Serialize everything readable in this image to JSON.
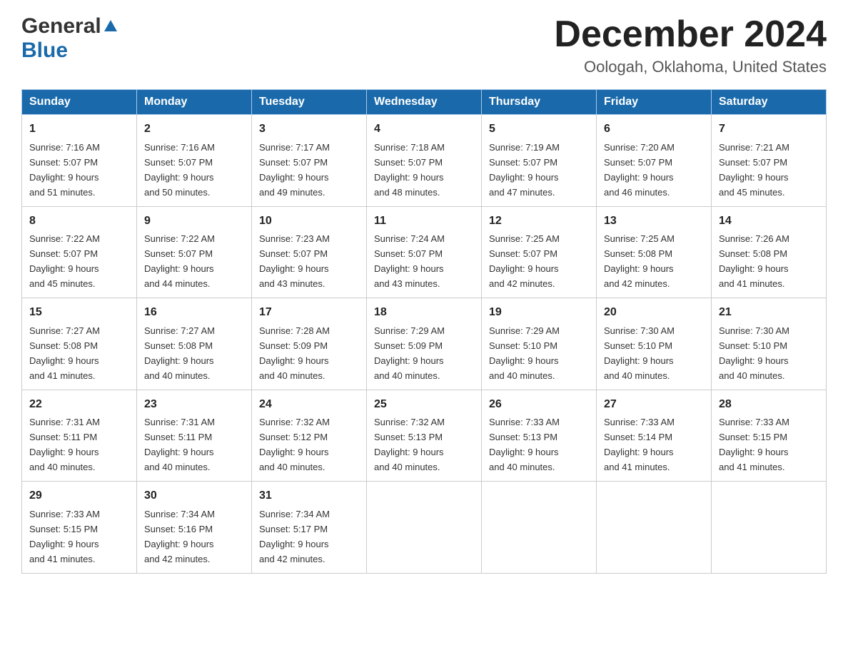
{
  "header": {
    "logo_general": "General",
    "logo_blue": "Blue",
    "month_title": "December 2024",
    "location": "Oologah, Oklahoma, United States"
  },
  "days_of_week": [
    "Sunday",
    "Monday",
    "Tuesday",
    "Wednesday",
    "Thursday",
    "Friday",
    "Saturday"
  ],
  "weeks": [
    [
      {
        "day": "1",
        "sunrise": "7:16 AM",
        "sunset": "5:07 PM",
        "daylight": "9 hours and 51 minutes."
      },
      {
        "day": "2",
        "sunrise": "7:16 AM",
        "sunset": "5:07 PM",
        "daylight": "9 hours and 50 minutes."
      },
      {
        "day": "3",
        "sunrise": "7:17 AM",
        "sunset": "5:07 PM",
        "daylight": "9 hours and 49 minutes."
      },
      {
        "day": "4",
        "sunrise": "7:18 AM",
        "sunset": "5:07 PM",
        "daylight": "9 hours and 48 minutes."
      },
      {
        "day": "5",
        "sunrise": "7:19 AM",
        "sunset": "5:07 PM",
        "daylight": "9 hours and 47 minutes."
      },
      {
        "day": "6",
        "sunrise": "7:20 AM",
        "sunset": "5:07 PM",
        "daylight": "9 hours and 46 minutes."
      },
      {
        "day": "7",
        "sunrise": "7:21 AM",
        "sunset": "5:07 PM",
        "daylight": "9 hours and 45 minutes."
      }
    ],
    [
      {
        "day": "8",
        "sunrise": "7:22 AM",
        "sunset": "5:07 PM",
        "daylight": "9 hours and 45 minutes."
      },
      {
        "day": "9",
        "sunrise": "7:22 AM",
        "sunset": "5:07 PM",
        "daylight": "9 hours and 44 minutes."
      },
      {
        "day": "10",
        "sunrise": "7:23 AM",
        "sunset": "5:07 PM",
        "daylight": "9 hours and 43 minutes."
      },
      {
        "day": "11",
        "sunrise": "7:24 AM",
        "sunset": "5:07 PM",
        "daylight": "9 hours and 43 minutes."
      },
      {
        "day": "12",
        "sunrise": "7:25 AM",
        "sunset": "5:07 PM",
        "daylight": "9 hours and 42 minutes."
      },
      {
        "day": "13",
        "sunrise": "7:25 AM",
        "sunset": "5:08 PM",
        "daylight": "9 hours and 42 minutes."
      },
      {
        "day": "14",
        "sunrise": "7:26 AM",
        "sunset": "5:08 PM",
        "daylight": "9 hours and 41 minutes."
      }
    ],
    [
      {
        "day": "15",
        "sunrise": "7:27 AM",
        "sunset": "5:08 PM",
        "daylight": "9 hours and 41 minutes."
      },
      {
        "day": "16",
        "sunrise": "7:27 AM",
        "sunset": "5:08 PM",
        "daylight": "9 hours and 40 minutes."
      },
      {
        "day": "17",
        "sunrise": "7:28 AM",
        "sunset": "5:09 PM",
        "daylight": "9 hours and 40 minutes."
      },
      {
        "day": "18",
        "sunrise": "7:29 AM",
        "sunset": "5:09 PM",
        "daylight": "9 hours and 40 minutes."
      },
      {
        "day": "19",
        "sunrise": "7:29 AM",
        "sunset": "5:10 PM",
        "daylight": "9 hours and 40 minutes."
      },
      {
        "day": "20",
        "sunrise": "7:30 AM",
        "sunset": "5:10 PM",
        "daylight": "9 hours and 40 minutes."
      },
      {
        "day": "21",
        "sunrise": "7:30 AM",
        "sunset": "5:10 PM",
        "daylight": "9 hours and 40 minutes."
      }
    ],
    [
      {
        "day": "22",
        "sunrise": "7:31 AM",
        "sunset": "5:11 PM",
        "daylight": "9 hours and 40 minutes."
      },
      {
        "day": "23",
        "sunrise": "7:31 AM",
        "sunset": "5:11 PM",
        "daylight": "9 hours and 40 minutes."
      },
      {
        "day": "24",
        "sunrise": "7:32 AM",
        "sunset": "5:12 PM",
        "daylight": "9 hours and 40 minutes."
      },
      {
        "day": "25",
        "sunrise": "7:32 AM",
        "sunset": "5:13 PM",
        "daylight": "9 hours and 40 minutes."
      },
      {
        "day": "26",
        "sunrise": "7:33 AM",
        "sunset": "5:13 PM",
        "daylight": "9 hours and 40 minutes."
      },
      {
        "day": "27",
        "sunrise": "7:33 AM",
        "sunset": "5:14 PM",
        "daylight": "9 hours and 41 minutes."
      },
      {
        "day": "28",
        "sunrise": "7:33 AM",
        "sunset": "5:15 PM",
        "daylight": "9 hours and 41 minutes."
      }
    ],
    [
      {
        "day": "29",
        "sunrise": "7:33 AM",
        "sunset": "5:15 PM",
        "daylight": "9 hours and 41 minutes."
      },
      {
        "day": "30",
        "sunrise": "7:34 AM",
        "sunset": "5:16 PM",
        "daylight": "9 hours and 42 minutes."
      },
      {
        "day": "31",
        "sunrise": "7:34 AM",
        "sunset": "5:17 PM",
        "daylight": "9 hours and 42 minutes."
      },
      null,
      null,
      null,
      null
    ]
  ],
  "labels": {
    "sunrise": "Sunrise:",
    "sunset": "Sunset:",
    "daylight": "Daylight:"
  }
}
